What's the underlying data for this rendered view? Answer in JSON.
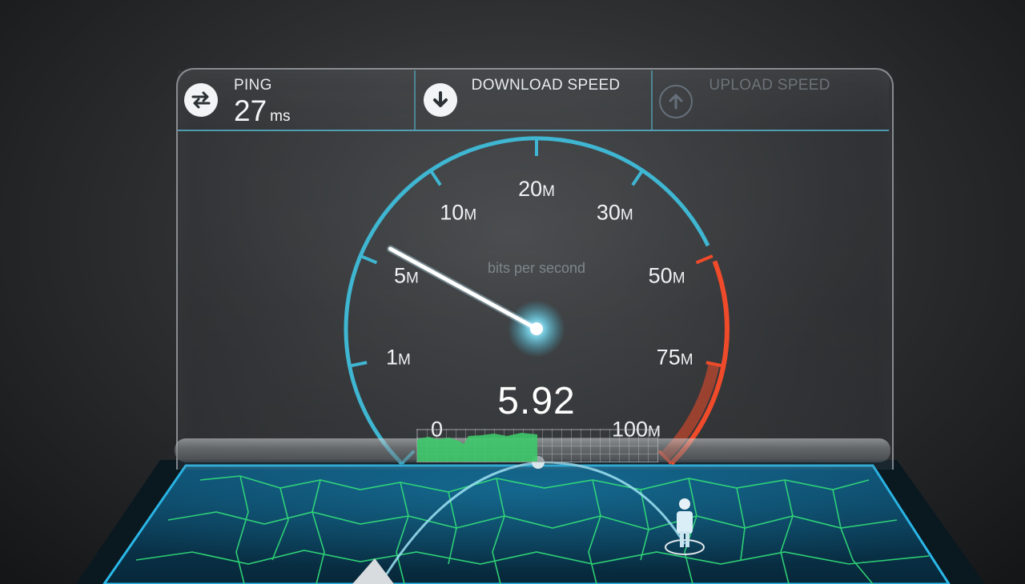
{
  "header": {
    "ping": {
      "label": "PING",
      "value": "27",
      "unit": "ms",
      "icon": "ping-exchange-icon"
    },
    "download": {
      "label": "DOWNLOAD SPEED",
      "icon": "download-arrow-icon"
    },
    "upload": {
      "label": "UPLOAD SPEED",
      "icon": "upload-arrow-icon"
    }
  },
  "gauge": {
    "unit_caption": "bits per second",
    "reading": "5.92",
    "needle_value_mbps": 5.92,
    "ticks": [
      {
        "main": "0",
        "suffix": ""
      },
      {
        "main": "1",
        "suffix": "M"
      },
      {
        "main": "5",
        "suffix": "M"
      },
      {
        "main": "10",
        "suffix": "M"
      },
      {
        "main": "20",
        "suffix": "M"
      },
      {
        "main": "30",
        "suffix": "M"
      },
      {
        "main": "50",
        "suffix": "M"
      },
      {
        "main": "75",
        "suffix": "M"
      },
      {
        "main": "100",
        "suffix": "M"
      }
    ]
  },
  "colors": {
    "arc_blue": "#3fb6d2",
    "arc_red": "#ef4a2a",
    "graph_green": "#3ec96a",
    "map_lines": "#33e07a",
    "map_bg": "#0b3a55"
  },
  "graph": {
    "fill_fraction": 0.5
  }
}
